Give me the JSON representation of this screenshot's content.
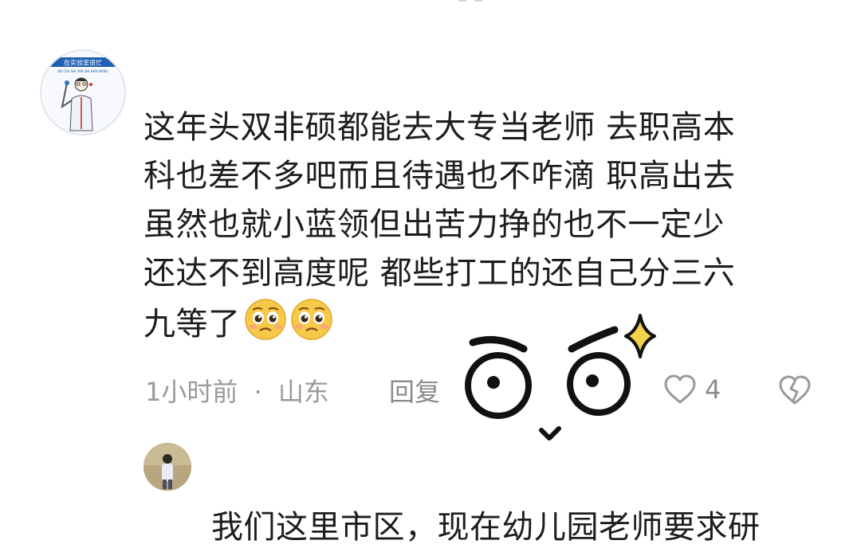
{
  "comment1": {
    "avatar_text": "在实验室很忙",
    "avatar_subtext": "WO ZAI SHI YAN SHI HEN MANG",
    "lines": [
      "这年头双非硕都能去大专当老师 去职高本",
      "科也差不多吧而且待遇也不咋滴 职高出去",
      "虽然也就小蓝领但出苦力挣的也不一定少",
      "还达不到高度呢 都些打工的还自己分三六",
      "九等了"
    ],
    "time": "1小时前",
    "separator": "·",
    "location": "山东",
    "reply_label": "回复",
    "like_count": "4",
    "emojis": [
      "pleading-face",
      "pleading-face"
    ]
  },
  "comment2": {
    "lines": [
      "我们这里市区，现在幼儿园老师要求研"
    ]
  },
  "colors": {
    "text": "#1d1d1d",
    "meta": "#9a9a9a",
    "emoji_yellow": "#f7c948",
    "sparkle": "#f3d24a"
  }
}
